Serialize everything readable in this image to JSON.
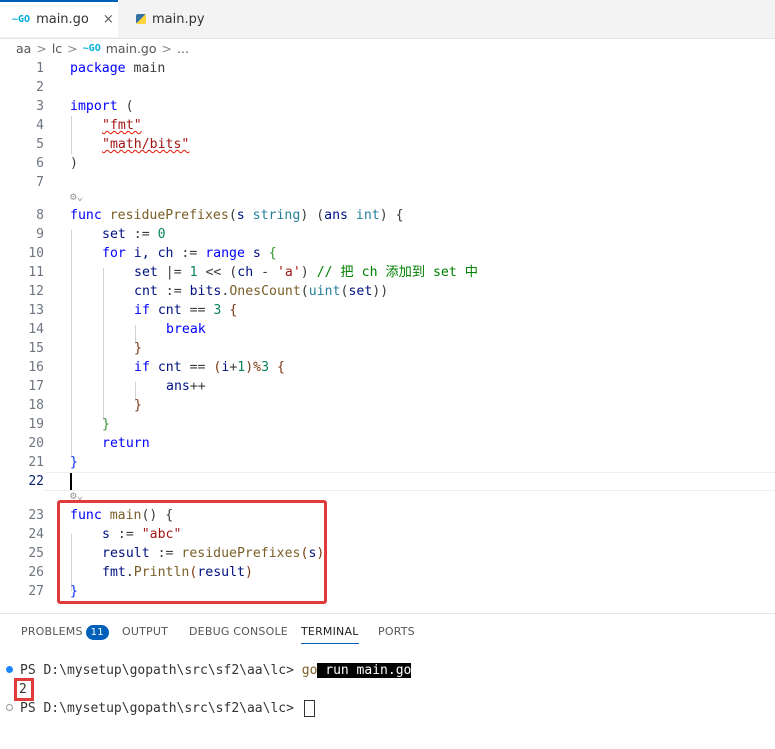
{
  "tabs": [
    {
      "label": "main.go",
      "icon": "go-icon",
      "active": true,
      "close": "×"
    },
    {
      "label": "main.py",
      "icon": "python-icon",
      "active": false
    }
  ],
  "breadcrumb": {
    "items": [
      "aa",
      "lc",
      "main.go",
      "..."
    ],
    "separator": ">"
  },
  "editor": {
    "line_numbers": [
      "1",
      "2",
      "3",
      "4",
      "5",
      "6",
      "7",
      "8",
      "9",
      "10",
      "11",
      "12",
      "13",
      "14",
      "15",
      "16",
      "17",
      "18",
      "19",
      "20",
      "21",
      "22",
      "23",
      "24",
      "25",
      "26",
      "27"
    ],
    "current_line": "22",
    "codelens_glyph": "⚙⌄",
    "code": {
      "l1_kw": "package",
      "l1_rest": " main",
      "l3_kw": "import",
      "l3_rest": " (",
      "l4": "\"fmt\"",
      "l5": "\"math/bits\"",
      "l6": ")",
      "l8_kw": "func",
      "l8_fn": "residuePrefixes",
      "l8_p1": "(",
      "l8_v1": "s",
      "l8_t1": "string",
      "l8_p2": ") (",
      "l8_v2": "ans",
      "l8_t2": "int",
      "l8_p3": ") {",
      "l9_v": "set",
      "l9_op": " := ",
      "l9_n": "0",
      "l10_kw": "for",
      "l10_v": " i, ch",
      "l10_op": " := ",
      "l10_kw2": "range",
      "l10_rest": " s ",
      "l10_b": "{",
      "l11_v": "set",
      "l11_op": " |= ",
      "l11_n": "1",
      "l11_a": " << (",
      "l11_v2": "ch",
      "l11_b": " - ",
      "l11_s": "'a'",
      "l11_c": ") ",
      "l11_cm": "// 把 ch 添加到 set 中",
      "l12_v": "cnt",
      "l12_op": " := ",
      "l12_pk": "bits",
      "l12_dot": ".",
      "l12_fn": "OnesCount",
      "l12_a": "(",
      "l12_t": "uint",
      "l12_b": "(",
      "l12_v2": "set",
      "l12_c": "))",
      "l13_kw": "if",
      "l13_v": " cnt",
      "l13_op": " == ",
      "l13_n": "3",
      "l13_b": " {",
      "l14_kw": "break",
      "l15": "}",
      "l16_kw": "if",
      "l16_v": " cnt",
      "l16_op": " == ",
      "l16_a": "(",
      "l16_v2": "i",
      "l16_p": "+",
      "l16_n": "1",
      "l16_b": ")%",
      "l16_n2": "3",
      "l16_c": " {",
      "l17_v": "ans",
      "l17_op": "++",
      "l18": "}",
      "l19": "}",
      "l20_kw": "return",
      "l21": "}",
      "l23_kw": "func",
      "l23_fn": " main",
      "l23_rest": "() {",
      "l24_v": "s",
      "l24_op": " := ",
      "l24_s": "\"abc\"",
      "l25_v": "result",
      "l25_op": " := ",
      "l25_fn": "residuePrefixes",
      "l25_a": "(",
      "l25_v2": "s",
      "l25_b": ")",
      "l26_pk": "fmt",
      "l26_dot": ".",
      "l26_fn": "Println",
      "l26_a": "(",
      "l26_v": "result",
      "l26_b": ")",
      "l27": "}"
    }
  },
  "panel": {
    "tabs": [
      "PROBLEMS",
      "OUTPUT",
      "DEBUG CONSOLE",
      "TERMINAL",
      "PORTS"
    ],
    "problems_count": "11",
    "active_tab": "TERMINAL"
  },
  "terminal": {
    "prompt1": "PS D:\\mysetup\\gopath\\src\\sf2\\aa\\lc> ",
    "cmd_go": "go",
    "cmd_rest": " run main.go",
    "output": "2",
    "prompt2": "PS D:\\mysetup\\gopath\\src\\sf2\\aa\\lc> "
  },
  "colors": {
    "accent": "#005fb8",
    "highlight_box": "#e23b3b",
    "go_icon": "#00add8"
  }
}
